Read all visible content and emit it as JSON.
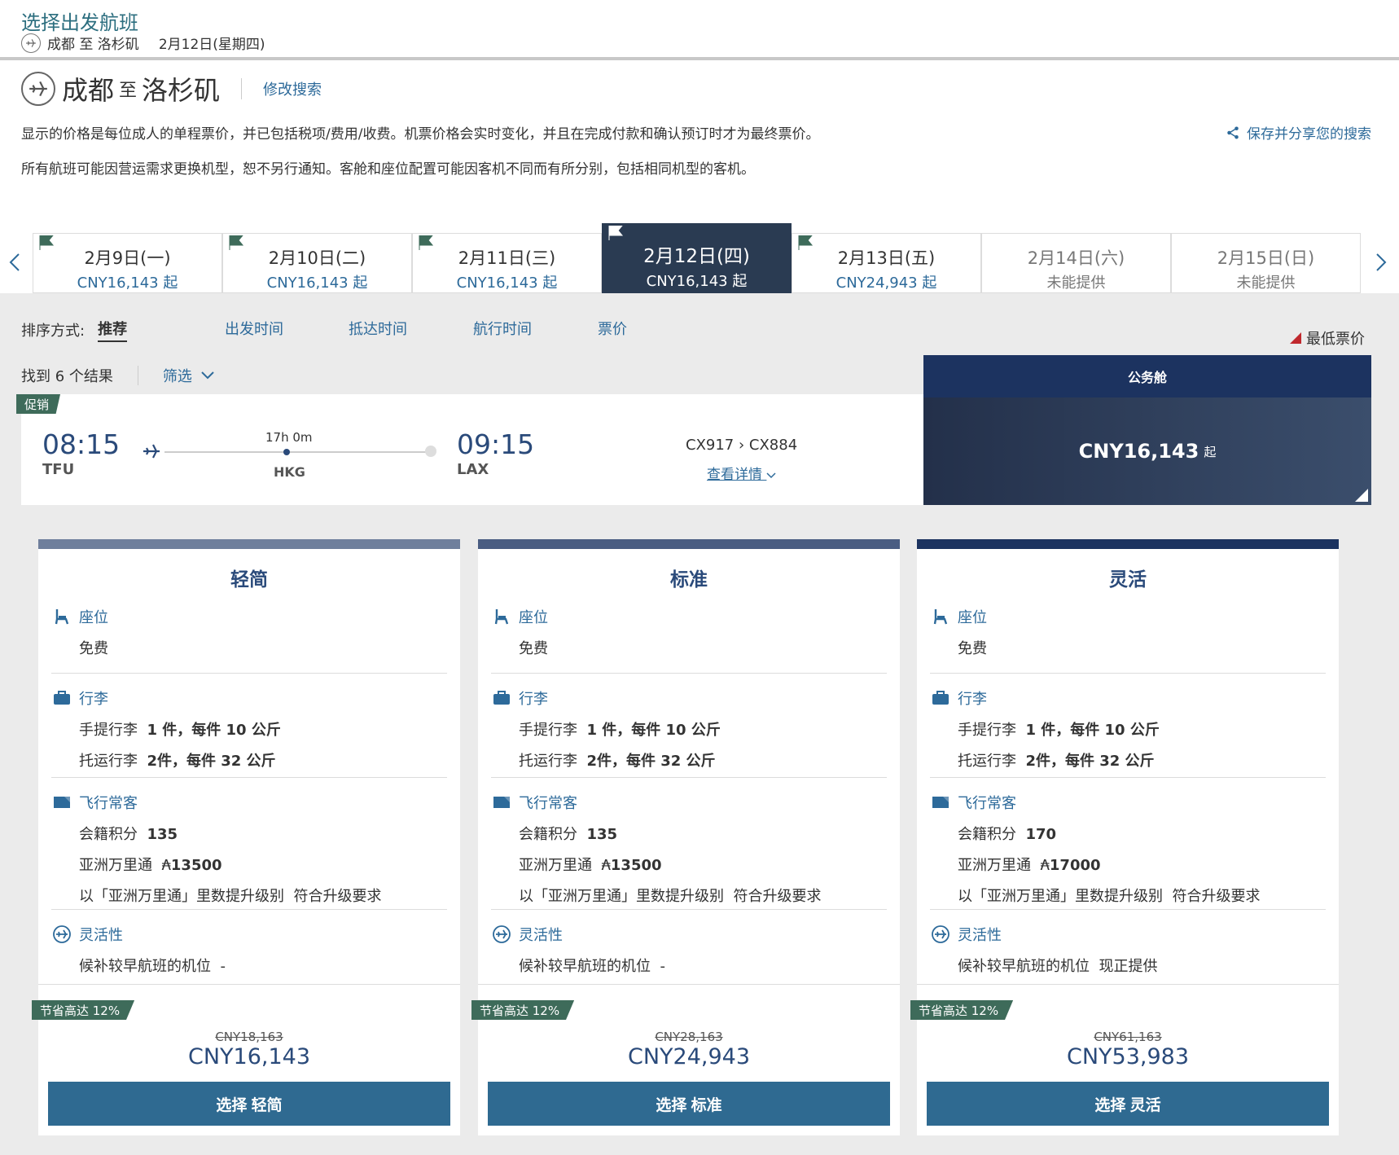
{
  "topbar": {
    "title": "选择出发航班",
    "route": "成都 至 洛杉矶",
    "date": "2月12日(星期四)"
  },
  "header": {
    "origin": "成都",
    "to": "至",
    "destination": "洛杉矶",
    "modify_label": "修改搜索",
    "notice1": "显示的价格是每位成人的单程票价，并已包括税项/费用/收费。机票价格会实时变化，并且在完成付款和确认预订时才为最终票价。",
    "notice2": "所有航班可能因营运需求更换机型，恕不另行通知。客舱和座位配置可能因客机不同而有所分别，包括相同机型的客机。",
    "save_share": "保存并分享您的搜索"
  },
  "dates": [
    {
      "date": "2月9日(一)",
      "price": "CNY16,143 起"
    },
    {
      "date": "2月10日(二)",
      "price": "CNY16,143 起"
    },
    {
      "date": "2月11日(三)",
      "price": "CNY16,143 起"
    },
    {
      "date": "2月12日(四)",
      "price": "CNY16,143 起"
    },
    {
      "date": "2月13日(五)",
      "price": "CNY24,943 起"
    },
    {
      "date": "2月14日(六)",
      "price": "未能提供"
    },
    {
      "date": "2月15日(日)",
      "price": "未能提供"
    }
  ],
  "sort": {
    "label": "排序方式:",
    "active": "推荐",
    "options": [
      "出发时间",
      "抵达时间",
      "航行时间",
      "票价"
    ],
    "lowest_label": "最低票价"
  },
  "results": {
    "count_text": "找到 6 个结果",
    "filter_label": "筛选",
    "cabin_header": "公务舱"
  },
  "flight": {
    "promo": "促销",
    "dep_time": "08:15",
    "dep_code": "TFU",
    "duration": "17h 0m",
    "stop": "HKG",
    "arr_time": "09:15",
    "arr_code": "LAX",
    "flight_numbers": "CX917 › CX884",
    "details_link": "查看详情",
    "price": "CNY16,143",
    "price_suffix": "起"
  },
  "fares": [
    {
      "name": "轻简",
      "bar_color": "#6f7f9c",
      "seat_head": "座位",
      "seat_value": "免费",
      "bag_head": "行李",
      "carry_label": "手提行李",
      "carry_value": "1 件，每件 10 公斤",
      "checked_label": "托运行李",
      "checked_value": "2件，每件 32 公斤",
      "ff_head": "飞行常客",
      "club_label": "会籍积分",
      "club_value": "135",
      "miles_label": "亚洲万里通",
      "miles_value": "13500",
      "upgrade_label": "以「亚洲万里通」里数提升级别",
      "upgrade_value": "符合升级要求",
      "flex_head": "灵活性",
      "standby_label": "候补较早航班的机位",
      "standby_value": "-",
      "save_tag": "节省高达 12%",
      "orig_price": "CNY18,163",
      "new_price": "CNY16,143",
      "button": "选择 轻简"
    },
    {
      "name": "标准",
      "bar_color": "#4a5d82",
      "seat_head": "座位",
      "seat_value": "免费",
      "bag_head": "行李",
      "carry_label": "手提行李",
      "carry_value": "1 件，每件 10 公斤",
      "checked_label": "托运行李",
      "checked_value": "2件，每件 32 公斤",
      "ff_head": "飞行常客",
      "club_label": "会籍积分",
      "club_value": "135",
      "miles_label": "亚洲万里通",
      "miles_value": "13500",
      "upgrade_label": "以「亚洲万里通」里数提升级别",
      "upgrade_value": "符合升级要求",
      "flex_head": "灵活性",
      "standby_label": "候补较早航班的机位",
      "standby_value": "-",
      "save_tag": "节省高达 12%",
      "orig_price": "CNY28,163",
      "new_price": "CNY24,943",
      "button": "选择 标准"
    },
    {
      "name": "灵活",
      "bar_color": "#1c3360",
      "seat_head": "座位",
      "seat_value": "免费",
      "bag_head": "行李",
      "carry_label": "手提行李",
      "carry_value": "1 件，每件 10 公斤",
      "checked_label": "托运行李",
      "checked_value": "2件，每件 32 公斤",
      "ff_head": "飞行常客",
      "club_label": "会籍积分",
      "club_value": "170",
      "miles_label": "亚洲万里通",
      "miles_value": "17000",
      "upgrade_label": "以「亚洲万里通」里数提升级别",
      "upgrade_value": "符合升级要求",
      "flex_head": "灵活性",
      "standby_label": "候补较早航班的机位",
      "standby_value": "现正提供",
      "save_tag": "节省高达 12%",
      "orig_price": "CNY61,163",
      "new_price": "CNY53,983",
      "button": "选择 灵活"
    }
  ],
  "colors": {
    "accent_blue": "#2d6a9a",
    "navy": "#1c3360",
    "promo_green": "#3e6b5a",
    "button_blue": "#2f6a91",
    "lowest_red": "#c0282d"
  }
}
